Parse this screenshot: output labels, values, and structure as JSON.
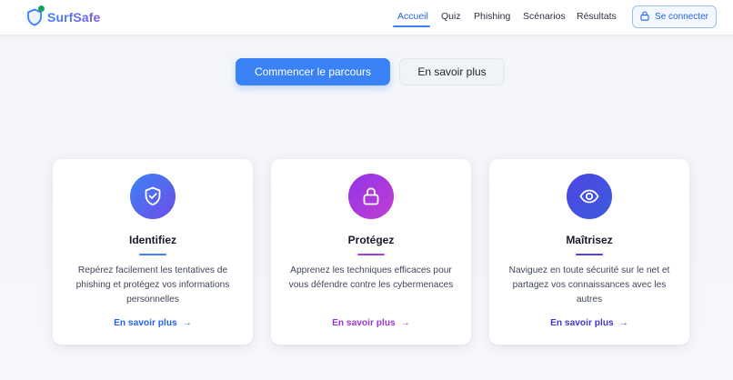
{
  "brand": {
    "name": "SurfSafe",
    "logo_icon": "shield-icon"
  },
  "nav": {
    "links": [
      {
        "label": "Accueil",
        "active": true
      },
      {
        "label": "Quiz",
        "active": false
      },
      {
        "label": "Phishing",
        "active": false
      },
      {
        "label": "Scénarios",
        "active": false
      },
      {
        "label": "Résultats",
        "active": false
      }
    ],
    "login": {
      "label": "Se connecter",
      "icon": "lock-icon"
    }
  },
  "hero": {
    "primary_cta": "Commencer le parcours",
    "secondary_cta": "En savoir plus"
  },
  "cards": [
    {
      "icon": "shield-check-icon",
      "title": "Identifiez",
      "description": "Repérez facilement les tentatives de phishing et protégez vos informations personnelles",
      "link": "En savoir plus",
      "accent": "#3b82f6"
    },
    {
      "icon": "lock-icon",
      "title": "Protégez",
      "description": "Apprenez les techniques efficaces pour vous défendre contre les cybermenaces",
      "link": "En savoir plus",
      "accent": "#a23fd6"
    },
    {
      "icon": "eye-icon",
      "title": "Maîtrisez",
      "description": "Naviguez en toute sécurité sur le net et partagez vos connaissances avec les autres",
      "link": "En savoir plus",
      "accent": "#4f46e5"
    }
  ],
  "colors": {
    "primary": "#3b82f6",
    "purple": "#9333ea",
    "indigo": "#4f46e5"
  }
}
